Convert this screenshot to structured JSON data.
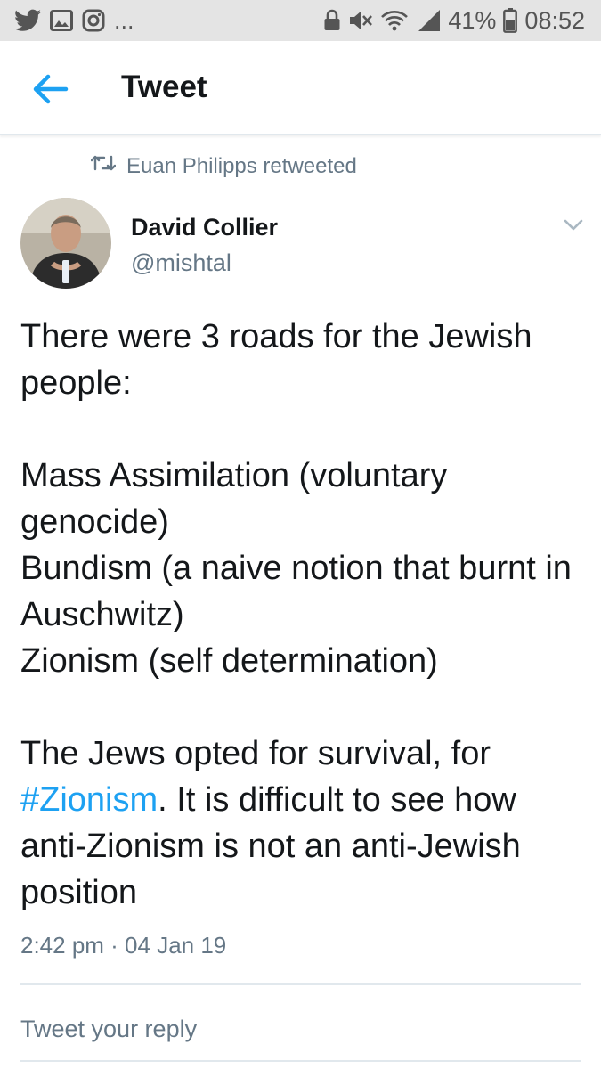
{
  "status_bar": {
    "left_icons": [
      "twitter-icon",
      "gallery-icon",
      "instagram-icon"
    ],
    "more_text": "...",
    "battery_text": "41%",
    "time_text": "08:52"
  },
  "header": {
    "title": "Tweet"
  },
  "tweet": {
    "retweeted_by": "Euan Philipps retweeted",
    "author_name": "David Collier",
    "author_handle": "@mishtal",
    "line1": "There were 3 roads for the Jewish people:",
    "line2": "Mass Assimilation (voluntary genocide)",
    "line3": "Bundism (a naive notion that burnt in Auschwitz)",
    "line4": "Zionism (self determination)",
    "line5_prefix": "The Jews opted for survival, for ",
    "hashtag": "#Zionism",
    "line5_suffix": ". It is difficult to see how anti-Zionism is not an anti-Jewish position",
    "timestamp": "2:42 pm · 04 Jan 19"
  },
  "reply": {
    "placeholder": "Tweet your reply"
  },
  "colors": {
    "accent": "#1da1f2",
    "secondary_text": "#657786",
    "primary_text": "#14171a",
    "status_bar_bg": "#e4e4e4"
  }
}
